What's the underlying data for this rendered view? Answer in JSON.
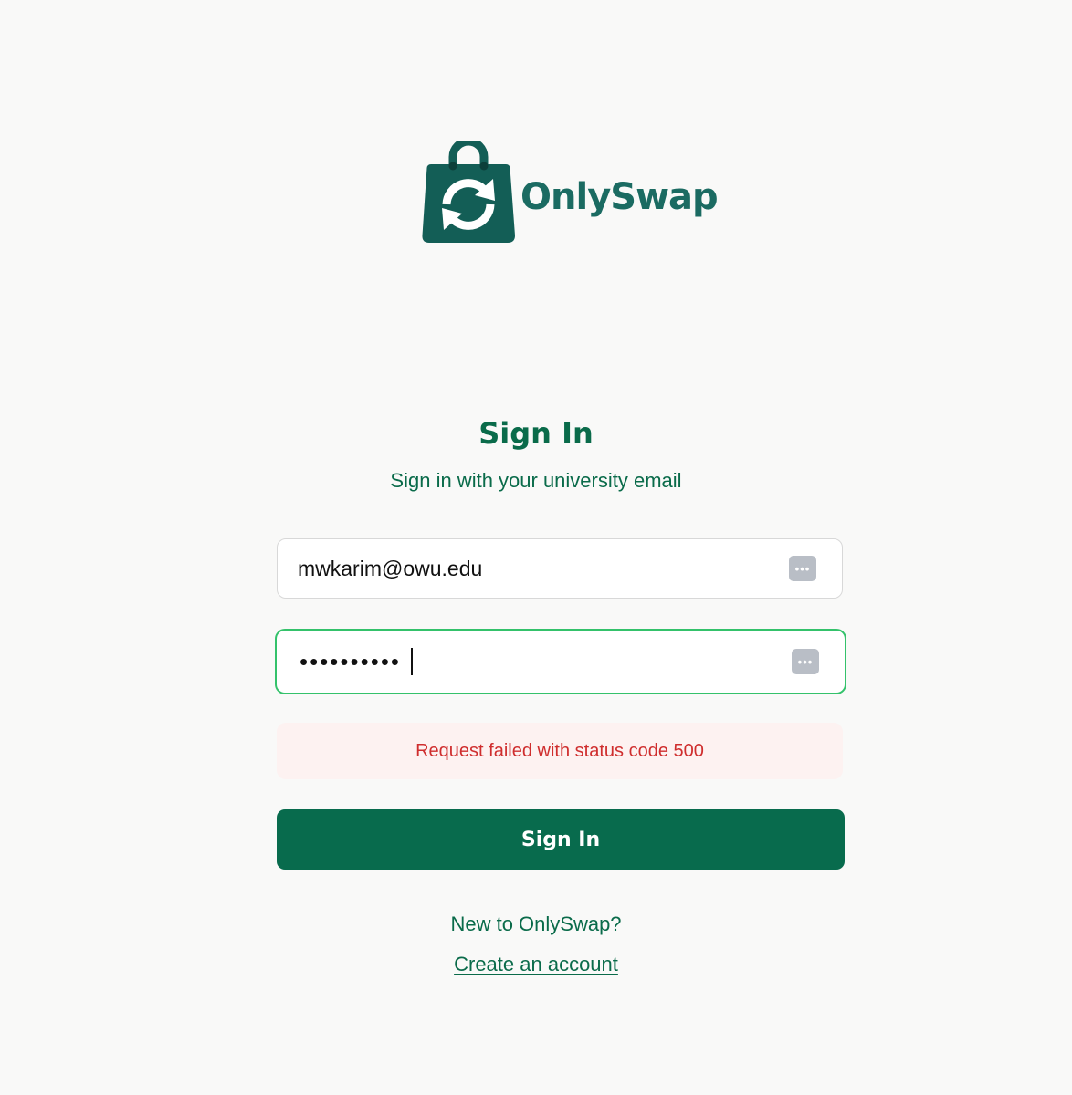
{
  "brand": {
    "name": "OnlySwap",
    "logo_icon": "shopping-bag-swap-icon",
    "primary_color": "#0a6b4a",
    "logo_color": "#135e56"
  },
  "signin": {
    "title": "Sign In",
    "subtitle": "Sign in with your university email",
    "email_value": "mwkarim@owu.edu",
    "password_value": "••••••••••",
    "password_manager_icon": "password-manager-key-icon",
    "error_message": "Request failed with status code 500",
    "error_color": "#cf2e2e",
    "submit_label": "Sign In",
    "new_prompt": "New to OnlySwap?",
    "create_account_label": "Create an account"
  }
}
